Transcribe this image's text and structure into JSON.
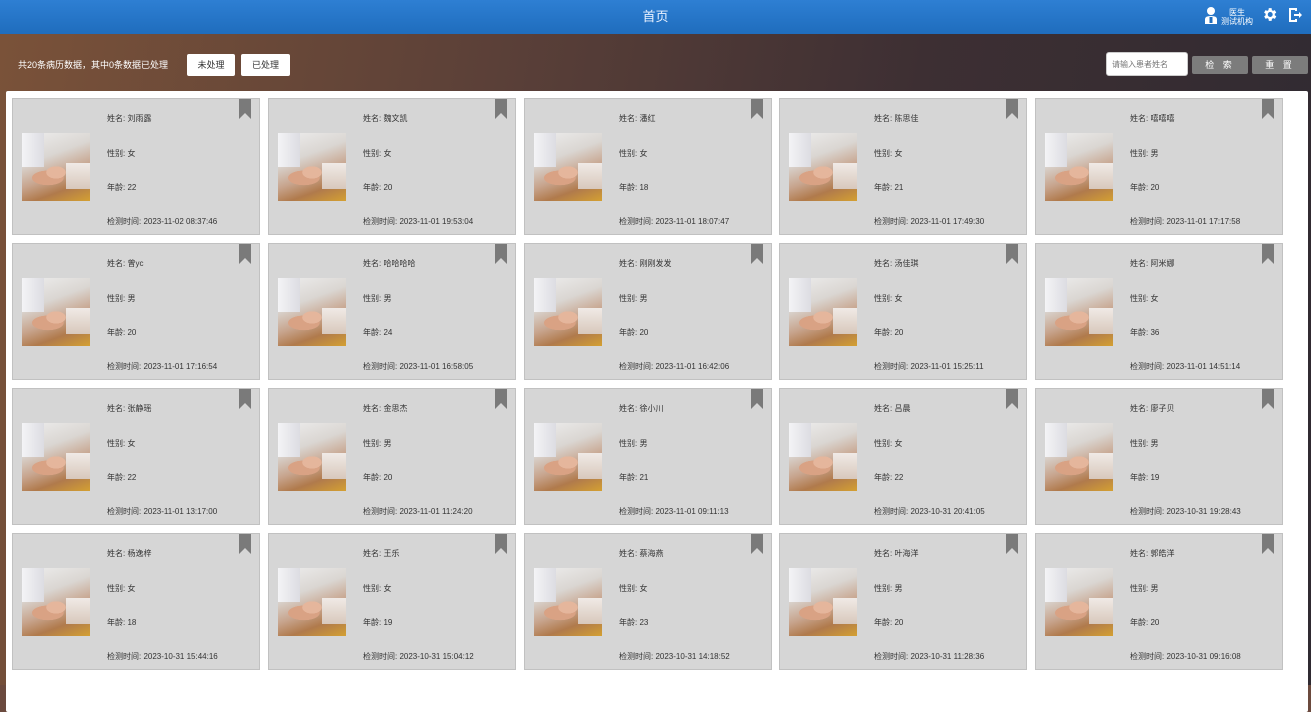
{
  "header": {
    "title": "首页",
    "user_role": "医生",
    "user_org": "测试机构",
    "settings_icon": "gear-icon",
    "logout_icon": "logout-icon"
  },
  "toolbar": {
    "summary": "共20条病历数据，其中0条数据已处理",
    "unprocessed_label": "未处理",
    "processed_label": "已处理",
    "search_placeholder": "请输入患者姓名",
    "search_label": "检 索",
    "reset_label": "重 置"
  },
  "labels": {
    "name": "姓名: ",
    "gender": "性别: ",
    "age": "年龄: ",
    "time": "检测时间: "
  },
  "records": [
    {
      "name": "刘雨露",
      "gender": "女",
      "age": "22",
      "time": "2023-11-02 08:37:46"
    },
    {
      "name": "魏文凯",
      "gender": "女",
      "age": "20",
      "time": "2023-11-01 19:53:04"
    },
    {
      "name": "潘红",
      "gender": "女",
      "age": "18",
      "time": "2023-11-01 18:07:47"
    },
    {
      "name": "陈思佳",
      "gender": "女",
      "age": "21",
      "time": "2023-11-01 17:49:30"
    },
    {
      "name": "嘻嘻嘻",
      "gender": "男",
      "age": "20",
      "time": "2023-11-01 17:17:58"
    },
    {
      "name": "曾yc",
      "gender": "男",
      "age": "20",
      "time": "2023-11-01 17:16:54"
    },
    {
      "name": "哈哈哈哈",
      "gender": "男",
      "age": "24",
      "time": "2023-11-01 16:58:05"
    },
    {
      "name": "刚刚发发",
      "gender": "男",
      "age": "20",
      "time": "2023-11-01 16:42:06"
    },
    {
      "name": "汤佳琪",
      "gender": "女",
      "age": "20",
      "time": "2023-11-01 15:25:11"
    },
    {
      "name": "阿米娜",
      "gender": "女",
      "age": "36",
      "time": "2023-11-01 14:51:14"
    },
    {
      "name": "张静瑶",
      "gender": "女",
      "age": "22",
      "time": "2023-11-01 13:17:00"
    },
    {
      "name": "金思杰",
      "gender": "男",
      "age": "20",
      "time": "2023-11-01 11:24:20"
    },
    {
      "name": "徐小川",
      "gender": "男",
      "age": "21",
      "time": "2023-11-01 09:11:13"
    },
    {
      "name": "吕晨",
      "gender": "女",
      "age": "22",
      "time": "2023-10-31 20:41:05"
    },
    {
      "name": "廖子贝",
      "gender": "男",
      "age": "19",
      "time": "2023-10-31 19:28:43"
    },
    {
      "name": "杨逸梓",
      "gender": "女",
      "age": "18",
      "time": "2023-10-31 15:44:16"
    },
    {
      "name": "王乐",
      "gender": "女",
      "age": "19",
      "time": "2023-10-31 15:04:12"
    },
    {
      "name": "蔡海燕",
      "gender": "女",
      "age": "23",
      "time": "2023-10-31 14:18:52"
    },
    {
      "name": "叶海洋",
      "gender": "男",
      "age": "20",
      "time": "2023-10-31 11:28:36"
    },
    {
      "name": "郭皓洋",
      "gender": "男",
      "age": "20",
      "time": "2023-10-31 09:16:08"
    }
  ],
  "colors": {
    "header_blue": "#1f6dbd",
    "card_bg": "#d6d6d6",
    "bookmark": "#7a7a7a"
  }
}
